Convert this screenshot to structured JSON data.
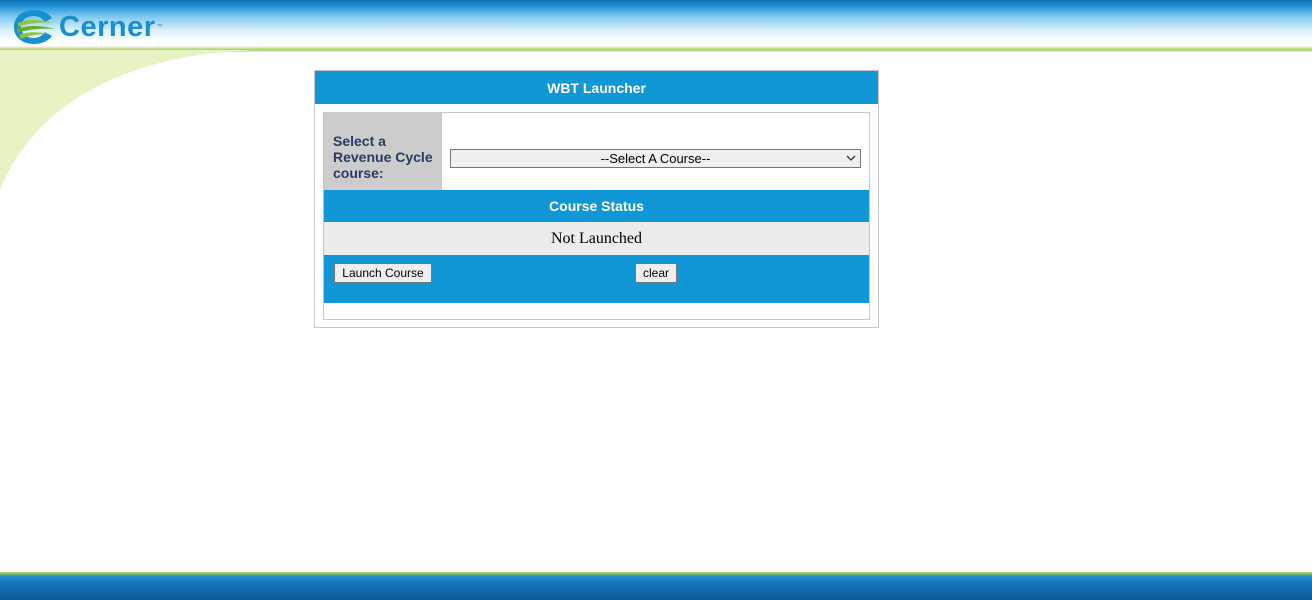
{
  "brand": {
    "name": "Cerner",
    "trademark": "™",
    "logo_icon": "cerner-swirl-logo",
    "colors": {
      "primary_blue": "#1196d6",
      "logo_blue": "#1a8fcf",
      "logo_green": "#8cc63f",
      "label_bg": "#cccccc",
      "label_text": "#2a3a63"
    }
  },
  "launcher": {
    "title": "WBT Launcher",
    "select_label": "Select a Revenue Cycle course:",
    "course_select": {
      "selected": "--Select A Course--",
      "icon": "chevron-down-icon"
    },
    "status_title": "Course Status",
    "status_value": "Not Launched",
    "launch_button": "Launch Course",
    "clear_button": "clear"
  }
}
